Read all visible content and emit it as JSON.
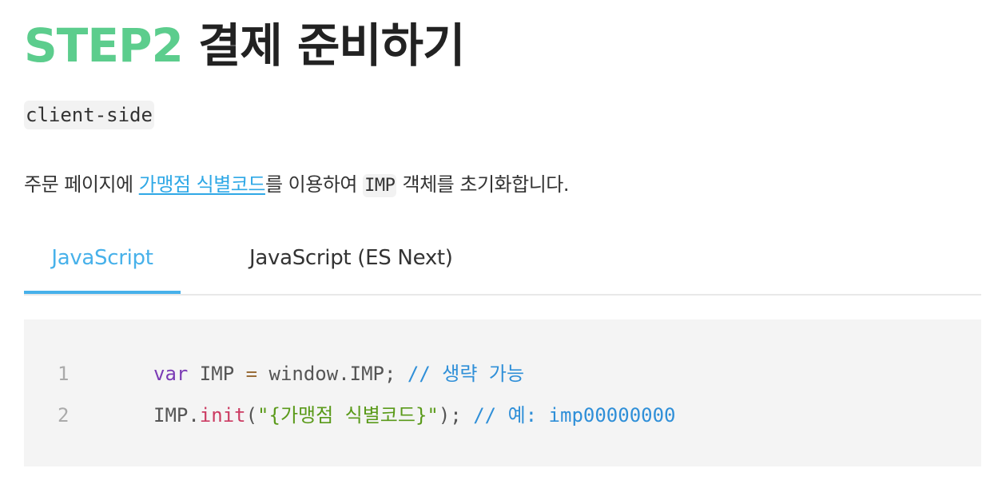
{
  "heading": {
    "step": "STEP2",
    "title": "결제 준비하기"
  },
  "badge": {
    "label": "client-side"
  },
  "description": {
    "before": "주문 페이지에 ",
    "link": "가맹점  식별코드",
    "middle": "를 이용하여 ",
    "code": "IMP",
    "after": " 객체를 초기화합니다."
  },
  "tabs": [
    {
      "label": "JavaScript",
      "active": true
    },
    {
      "label": "JavaScript (ES Next)",
      "active": false
    }
  ],
  "code": {
    "lines": [
      {
        "number": "1",
        "kw": "var",
        "ident": " IMP ",
        "op": "=",
        "rest": " window.IMP; ",
        "comment": "// 생략 가능"
      },
      {
        "number": "2",
        "obj": "IMP.",
        "fn": "init",
        "paren_open": "(",
        "str": "\"{가맹점 식별코드}\"",
        "paren_close": "); ",
        "comment": "// 예: imp00000000"
      }
    ]
  },
  "colors": {
    "step_green": "#5ccd8d",
    "accent_blue": "#47b1ea",
    "link_blue": "#2fa8e6",
    "code_bg": "#f4f4f4"
  }
}
